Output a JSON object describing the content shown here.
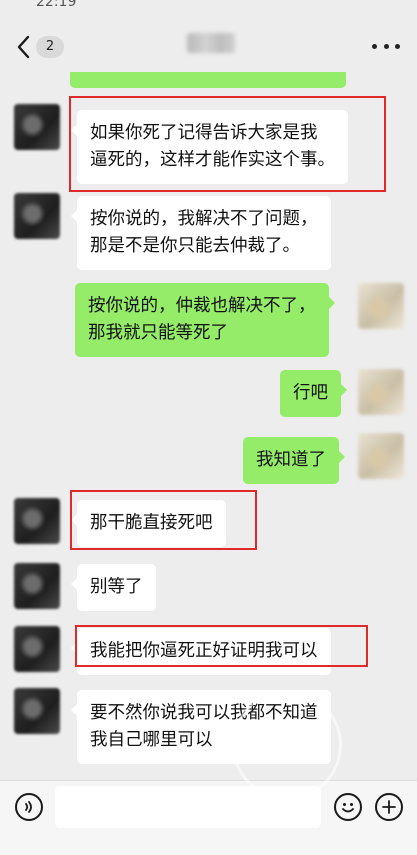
{
  "status": {
    "time": "22:19"
  },
  "header": {
    "unread_count": "2",
    "more_label": "•••"
  },
  "messages": [
    {
      "side": "out",
      "text": ""
    },
    {
      "side": "in",
      "lines": [
        "如果你死了记得告诉大家是我",
        "逼死的，这样才能作实这个事。"
      ],
      "highlighted": true
    },
    {
      "side": "in",
      "lines": [
        "按你说的，我解决不了问题，",
        "那是不是你只能去仲裁了。"
      ],
      "highlighted": false
    },
    {
      "side": "out",
      "lines": [
        "按你说的，仲裁也解决不了，",
        "那我就只能等死了"
      ],
      "highlighted": false
    },
    {
      "side": "out",
      "lines": [
        "行吧"
      ],
      "highlighted": false
    },
    {
      "side": "out",
      "lines": [
        "我知道了"
      ],
      "highlighted": false
    },
    {
      "side": "in",
      "lines": [
        "那干脆直接死吧"
      ],
      "highlighted": true
    },
    {
      "side": "in",
      "lines": [
        "别等了"
      ],
      "highlighted": false
    },
    {
      "side": "in",
      "lines": [
        "我能把你逼死正好证明我可以"
      ],
      "highlighted": true
    },
    {
      "side": "in",
      "lines": [
        "要不然你说我可以我都不知道",
        "我自己哪里可以"
      ],
      "highlighted": false
    }
  ],
  "input": {
    "placeholder": ""
  },
  "icons": {
    "back": "chevron-left-icon",
    "more": "more-dots-icon",
    "voice": "voice-icon",
    "emoji": "emoji-icon",
    "plus": "plus-icon"
  },
  "colors": {
    "outgoing_bubble": "#95ec69",
    "incoming_bubble": "#ffffff",
    "background": "#ededed",
    "highlight_box": "#e02a2a"
  }
}
